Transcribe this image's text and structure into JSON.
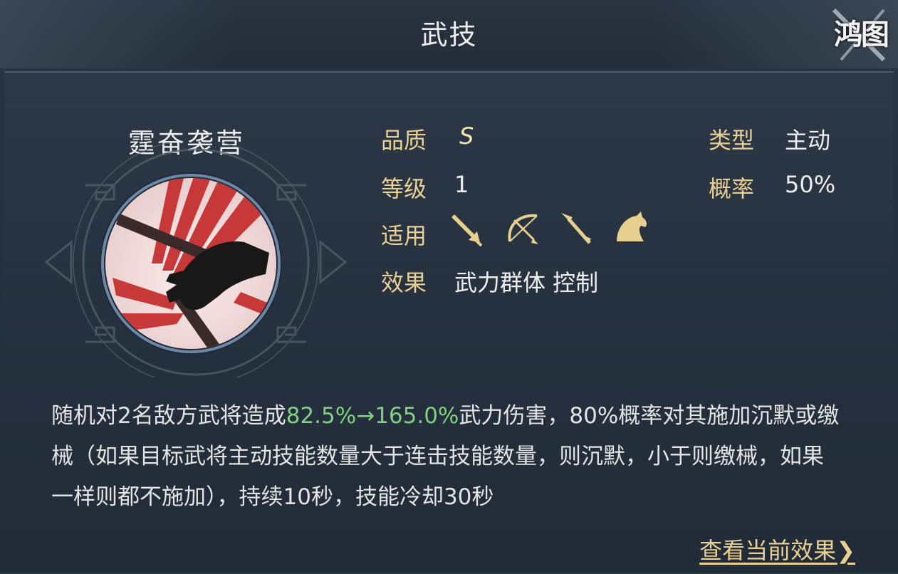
{
  "header": {
    "title": "武技",
    "logo_text": "鸿图"
  },
  "skill": {
    "name": "霆奋袭营",
    "icon": "fist-slash-icon"
  },
  "stats": {
    "quality_label": "品质",
    "quality_value": "S",
    "level_label": "等级",
    "level_value": "1",
    "apply_label": "适用",
    "effect_label": "效果",
    "effect_value": "武力群体 控制",
    "type_label": "类型",
    "type_value": "主动",
    "rate_label": "概率",
    "rate_value": "50%"
  },
  "weapons": [
    {
      "icon": "sword-icon"
    },
    {
      "icon": "bow-icon"
    },
    {
      "icon": "spear-icon"
    },
    {
      "icon": "horse-icon"
    }
  ],
  "description": {
    "part1": "随机对2名敌方武将造成",
    "highlight": "82.5%→165.0%",
    "part2": "武力伤害，80%概率对其施加沉默或缴械（如果目标武将主动技能数量大于连击技能数量，则沉默，小于则缴械，如果一样则都不施加），持续10秒，技能冷却30秒"
  },
  "footer": {
    "link_label": "查看当前效果"
  },
  "colors": {
    "label_gold": "#e8cf93",
    "highlight_green": "#7fd07f"
  }
}
